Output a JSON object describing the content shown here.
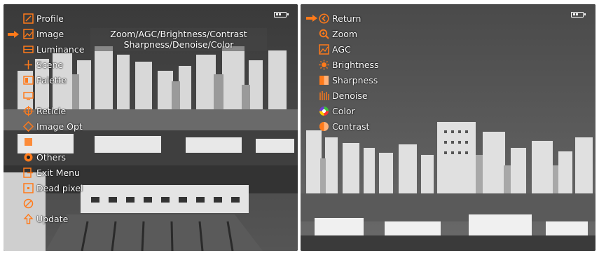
{
  "colors": {
    "accent": "#ff7a1a",
    "text": "#ffffff"
  },
  "left_screen": {
    "menu": [
      {
        "label": "Profile",
        "icon": "profile-icon"
      },
      {
        "label": "Image",
        "icon": "image-icon",
        "selected": true
      },
      {
        "label": "Luminance",
        "icon": "luminance-icon"
      },
      {
        "label": "Scene",
        "icon": "scene-icon"
      },
      {
        "label": "Palette",
        "icon": "palette-icon"
      },
      {
        "label": "",
        "icon": "display-icon"
      },
      {
        "label": "Reticle",
        "icon": "reticle-icon"
      },
      {
        "label": "Image Opt",
        "icon": "image-opt-icon"
      },
      {
        "label": "",
        "icon": "tools-icon"
      },
      {
        "label": "Others",
        "icon": "others-icon"
      },
      {
        "label": "Exit Menu",
        "icon": "exit-icon"
      },
      {
        "label": "Dead pixel",
        "icon": "dead-pixel-icon"
      },
      {
        "label": "",
        "icon": "disable-icon"
      },
      {
        "label": "Update",
        "icon": "update-icon"
      }
    ],
    "submenu_lines": [
      "Zoom/AGC/Brightness/Contrast",
      "Sharpness/Denoise/Color"
    ]
  },
  "right_screen": {
    "menu": [
      {
        "label": "Return",
        "icon": "return-icon",
        "selected": true
      },
      {
        "label": "Zoom",
        "icon": "zoom-icon"
      },
      {
        "label": "AGC",
        "icon": "agc-icon"
      },
      {
        "label": "Brightness",
        "icon": "brightness-icon"
      },
      {
        "label": "Sharpness",
        "icon": "sharpness-icon"
      },
      {
        "label": "Denoise",
        "icon": "denoise-icon"
      },
      {
        "label": "Color",
        "icon": "color-icon"
      },
      {
        "label": "Contrast",
        "icon": "contrast-icon"
      }
    ]
  }
}
